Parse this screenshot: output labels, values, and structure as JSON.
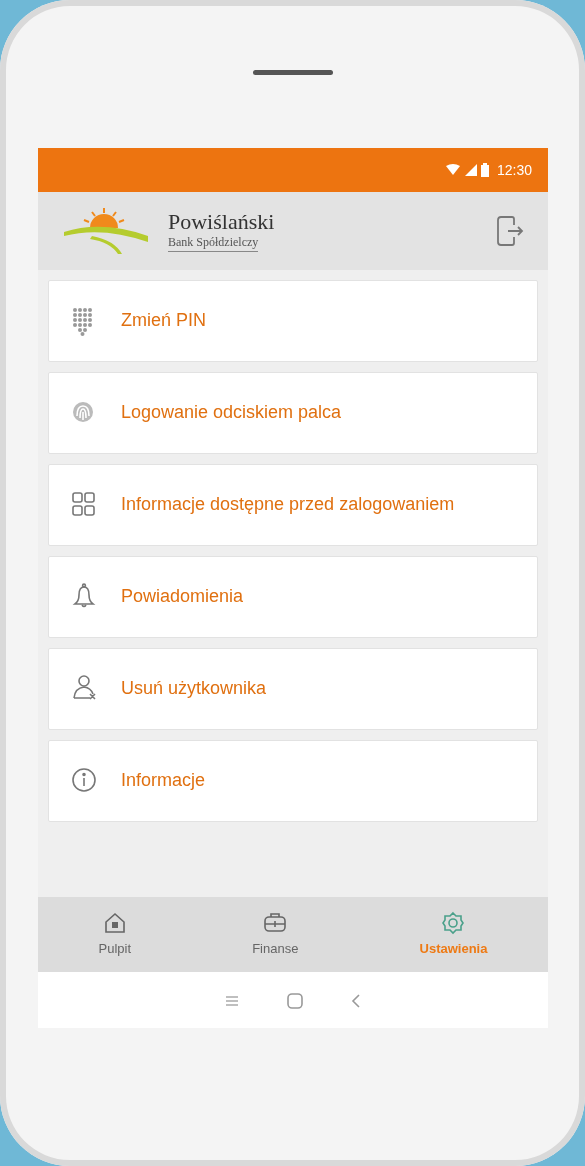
{
  "status_bar": {
    "time": "12:30"
  },
  "header": {
    "bank_name": "Powiślański",
    "bank_subtitle": "Bank Spółdzielczy"
  },
  "menu": [
    {
      "kind": "pin",
      "label": "Zmień PIN"
    },
    {
      "kind": "fingerprint",
      "label": "Logowanie odciskiem palca"
    },
    {
      "kind": "grid",
      "label": "Informacje dostępne przed zalogowaniem"
    },
    {
      "kind": "bell",
      "label": "Powiadomienia"
    },
    {
      "kind": "user",
      "label": "Usuń użytkownika"
    },
    {
      "kind": "info",
      "label": "Informacje"
    }
  ],
  "tabs": [
    {
      "kind": "home",
      "label": "Pulpit",
      "selected": false
    },
    {
      "kind": "wallet",
      "label": "Finanse",
      "selected": false
    },
    {
      "kind": "gear",
      "label": "Ustawienia",
      "selected": true
    }
  ]
}
